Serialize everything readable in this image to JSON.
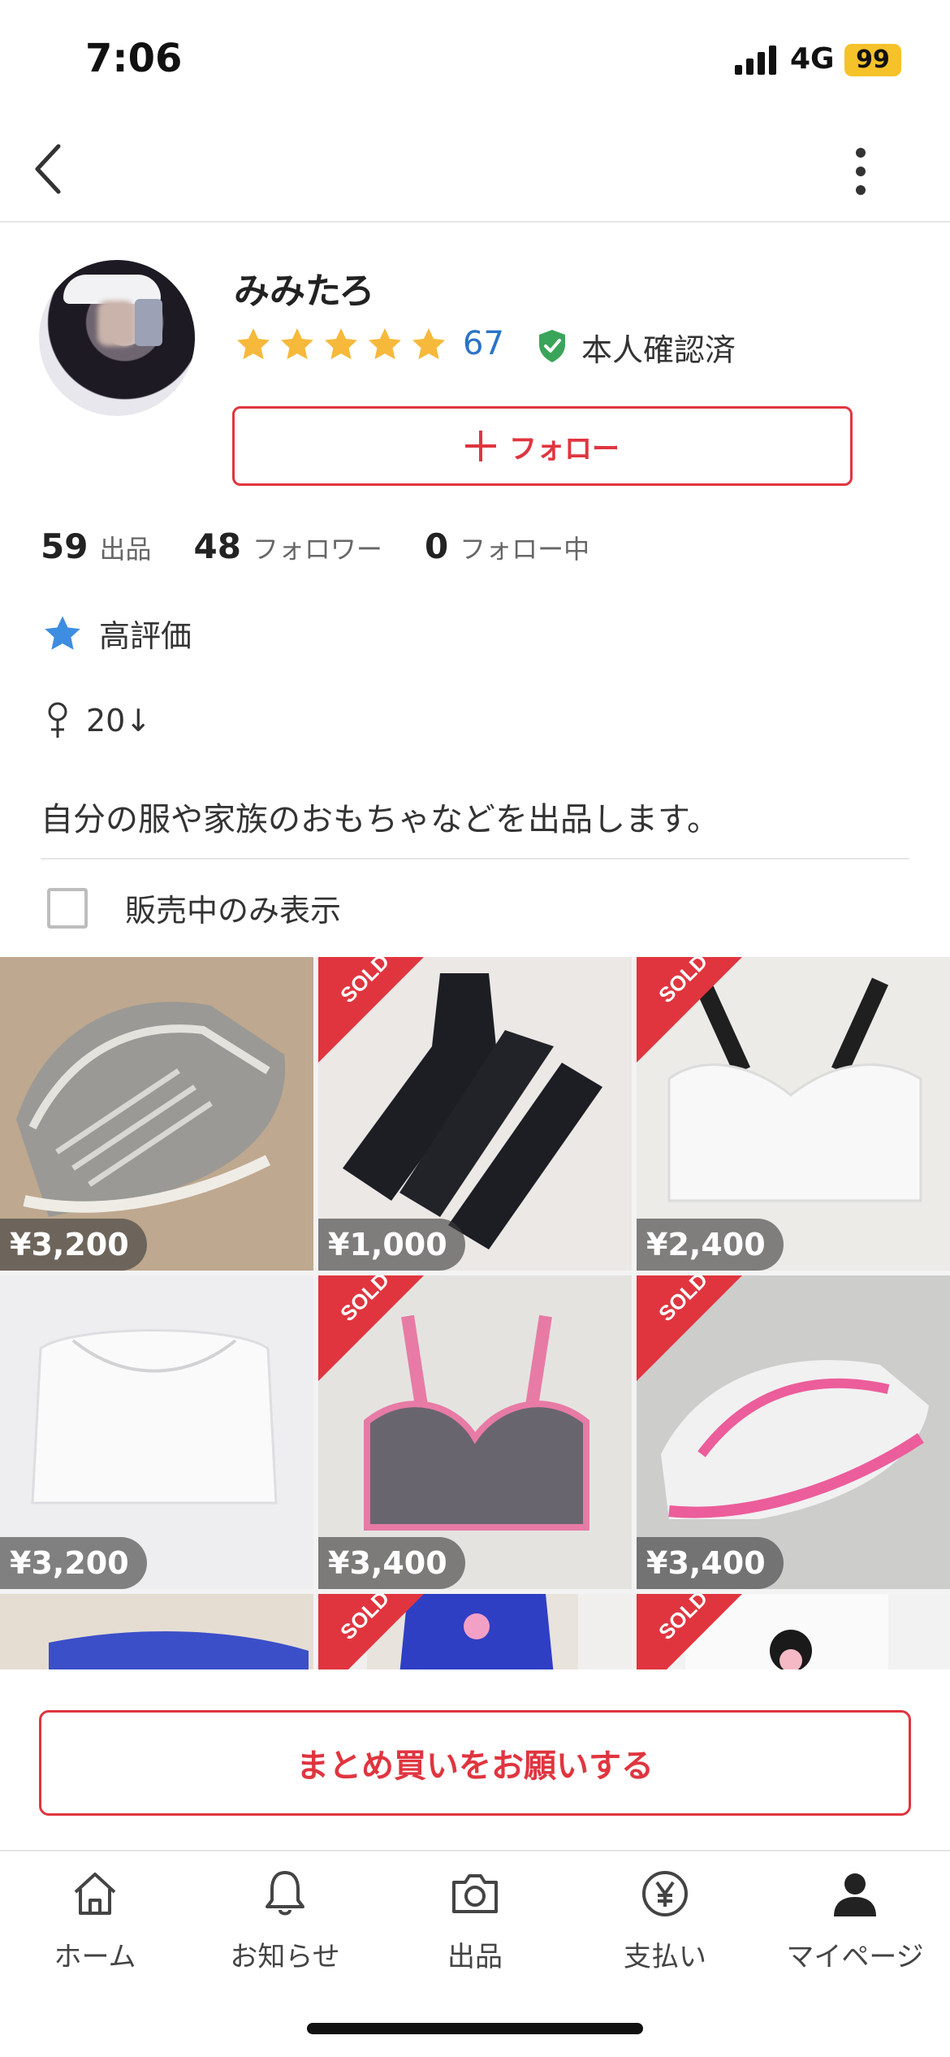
{
  "status": {
    "time": "7:06",
    "network": "4G",
    "battery": "99"
  },
  "nav": {
    "back_icon": "chevron-left-icon",
    "more_icon": "more-vertical-icon"
  },
  "profile": {
    "username": "みみたろ",
    "rating_stars": 5,
    "rating_count": "67",
    "verified_label": "本人確認済",
    "follow_label": "フォロー",
    "counts": [
      {
        "num": "59",
        "label": "出品"
      },
      {
        "num": "48",
        "label": "フォロワー"
      },
      {
        "num": "0",
        "label": "フォロー中"
      }
    ],
    "badge_label": "高評価",
    "gender_age": "20↓",
    "bio": "自分の服や家族のおもちゃなどを出品します。",
    "filter_label": "販売中のみ表示"
  },
  "items": [
    {
      "price": "¥3,200",
      "sold": false,
      "image": "grey-sneakers"
    },
    {
      "price": "¥1,000",
      "sold": true,
      "image": "black-socks"
    },
    {
      "price": "¥2,400",
      "sold": true,
      "image": "white-sports-bra"
    },
    {
      "price": "¥3,200",
      "sold": false,
      "image": "white-crop-top"
    },
    {
      "price": "¥3,400",
      "sold": true,
      "image": "grey-pink-bra"
    },
    {
      "price": "¥3,400",
      "sold": true,
      "image": "pink-white-sneakers"
    },
    {
      "price": "",
      "sold": false,
      "image": "blue-garment"
    },
    {
      "price": "",
      "sold": true,
      "image": "blue-uniform"
    },
    {
      "price": "",
      "sold": true,
      "image": "photo-item"
    }
  ],
  "sold_label": "SOLD",
  "bulk_button": "まとめ買いをお願いする",
  "tabs": [
    {
      "label": "ホーム",
      "icon": "home-icon"
    },
    {
      "label": "お知らせ",
      "icon": "bell-icon"
    },
    {
      "label": "出品",
      "icon": "camera-icon"
    },
    {
      "label": "支払い",
      "icon": "yen-icon"
    },
    {
      "label": "マイページ",
      "icon": "user-icon"
    }
  ],
  "colors": {
    "accent": "#e0353f",
    "star": "#f6b93b",
    "link": "#2a73c7",
    "verified": "#3aa55a"
  }
}
